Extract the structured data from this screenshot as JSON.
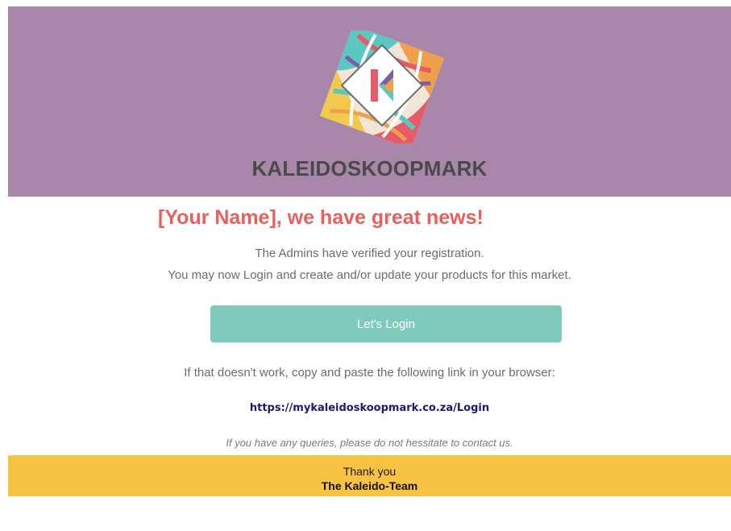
{
  "header": {
    "brand": "KALEIDOSKOOPMARK",
    "logo_icon": "kaleidoscope-k-logo",
    "logo_letter": "K",
    "bg_color": "#a887aa"
  },
  "content": {
    "headline": "[Your Name], we have great news!",
    "line1": "The Admins have verified your registration.",
    "line2": "You may now Login and create and/or update your products for this market.",
    "button_label": "Let's Login",
    "fallback_text": "If that doesn't work, copy and paste the following link in your browser:",
    "link": "https://mykaleidoskoopmark.co.za/Login",
    "queries": "If you have any queries, please do not hessitate to contact us."
  },
  "footer": {
    "thanks": "Thank you",
    "team": "The Kaleido-Team",
    "bg_color": "#f8c242"
  },
  "colors": {
    "headline": "#e8605e",
    "button": "#7ecbbe",
    "link": "#1a1a6e"
  }
}
